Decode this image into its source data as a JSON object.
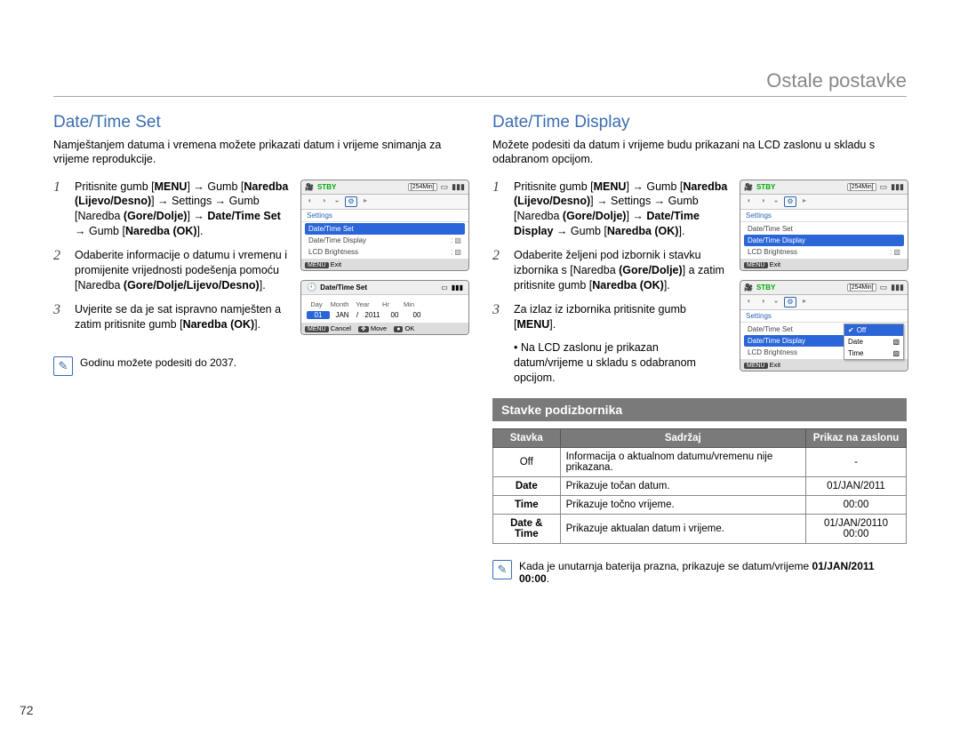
{
  "header": {
    "chapter": "Ostale postavke"
  },
  "pageNumber": "72",
  "left": {
    "title": "Date/Time Set",
    "intro": "Namještanjem datuma i vremena možete prikazati datum i vrijeme snimanja za vrijeme reprodukcije.",
    "steps": [
      "Pritisnite gumb [<b>MENU</b>] → Gumb [<b>Naredba (Lijevo/Desno)</b>] → Settings → Gumb [Naredba <b>(Gore/Dolje)</b>] → <b>Date/Time Set</b> → Gumb [<b>Naredba (OK)</b>].",
      "Odaberite informacije o datumu i vremenu i promijenite vrijednosti podešenja pomoću [Naredba <b>(Gore/Dolje/Lijevo/Desno)</b>].",
      "Uvjerite se da je sat ispravno namješten a zatim pritisnite gumb [<b>Naredba (OK)</b>]."
    ],
    "note": "Godinu možete podesiti do 2037.",
    "mini1": {
      "stby": "STBY",
      "mins": "[254Min]",
      "settings": "Settings",
      "items": [
        {
          "label": "Date/Time Set",
          "highlight": true
        },
        {
          "label": "Date/Time Display",
          "highlight": false,
          "right": ": ▧"
        },
        {
          "label": "LCD Brightness",
          "highlight": false,
          "right": ": ▧"
        }
      ],
      "exit": {
        "menu": "MENU",
        "exit": "Exit"
      }
    },
    "mini2": {
      "title": "Date/Time Set",
      "labels": [
        "Day",
        "Month",
        "Year",
        "Hr",
        "Min"
      ],
      "values": [
        "01",
        "JAN",
        "/",
        "2011",
        "00",
        "00"
      ],
      "foot": {
        "menu": "MENU",
        "cancel": "Cancel",
        "move": "Move",
        "ok": "OK"
      }
    }
  },
  "right": {
    "title": "Date/Time Display",
    "intro": "Možete podesiti da datum i vrijeme budu prikazani na LCD zaslonu u skladu s odabranom opcijom.",
    "steps": [
      "Pritisnite gumb [<b>MENU</b>] → Gumb [<b>Naredba (Lijevo/Desno)</b>] → Settings → Gumb [Naredba <b>(Gore/Dolje)</b>] → <b>Date/Time Display</b> → Gumb [<b>Naredba (OK)</b>].",
      "Odaberite željeni pod izbornik i stavku izbornika s [Naredba <b>(Gore/Dolje)</b>] a zatim pritisnite gumb [<b>Naredba (OK)</b>].",
      "Za izlaz iz izbornika pritisnite gumb [<b>MENU</b>]."
    ],
    "bullet": "Na LCD zaslonu je prikazan datum/vrijeme u skladu s odabranom opcijom.",
    "mini1": {
      "stby": "STBY",
      "mins": "[254Min]",
      "settings": "Settings",
      "items": [
        {
          "label": "Date/Time Set",
          "highlight": false
        },
        {
          "label": "Date/Time Display",
          "highlight": true
        },
        {
          "label": "LCD Brightness",
          "highlight": false,
          "right": ": ▧"
        }
      ],
      "exit": {
        "menu": "MENU",
        "exit": "Exit"
      }
    },
    "mini2": {
      "stby": "STBY",
      "mins": "[254Min]",
      "settings": "Settings",
      "items": [
        {
          "label": "Date/Time Set",
          "highlight": false
        },
        {
          "label": "Date/Time Display",
          "highlight": true
        },
        {
          "label": "LCD Brightness",
          "highlight": false
        }
      ],
      "popup": [
        {
          "label": "Off",
          "selected": true,
          "icon": "✔"
        },
        {
          "label": "Date",
          "icon": "▧"
        },
        {
          "label": "Time",
          "icon": "▧"
        }
      ],
      "exit": {
        "menu": "MENU",
        "exit": "Exit"
      }
    },
    "subHeader": "Stavke podizbornika",
    "table": {
      "head": [
        "Stavka",
        "Sadržaj",
        "Prikaz na zaslonu"
      ],
      "rows": [
        [
          "Off",
          "Informacija o aktualnom datumu/vremenu nije prikazana.",
          "-"
        ],
        [
          "<b>Date</b>",
          "Prikazuje točan datum.",
          "01/JAN/2011"
        ],
        [
          "<b>Time</b>",
          "Prikazuje točno vrijeme.",
          "00:00"
        ],
        [
          "<b>Date & Time</b>",
          "Prikazuje aktualan datum i vrijeme.",
          "01/JAN/20110 00:00"
        ]
      ]
    },
    "note": "Kada je unutarnja baterija prazna, prikazuje se datum/vrijeme <b>01/JAN/2011 00:00</b>."
  }
}
